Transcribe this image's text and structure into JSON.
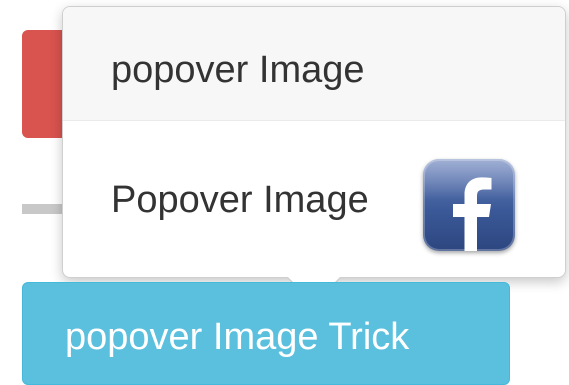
{
  "popover": {
    "title": "popover Image",
    "content_text": "Popover Image",
    "icon": "facebook-icon"
  },
  "button": {
    "label": "popover Image Trick"
  },
  "colors": {
    "danger": "#d9534f",
    "info": "#5bc0de",
    "facebook": "#3b5998"
  }
}
